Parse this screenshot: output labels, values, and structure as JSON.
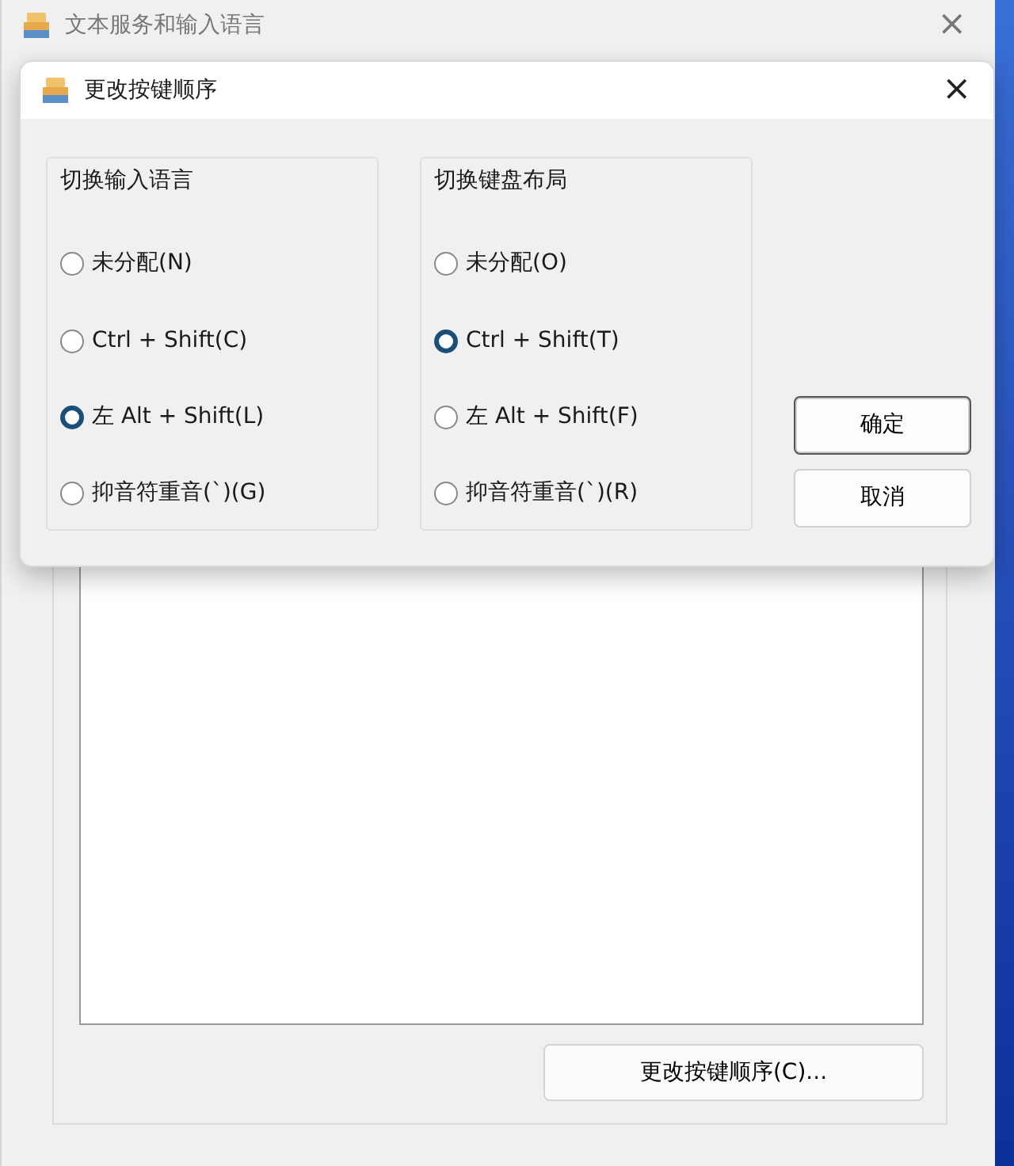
{
  "background_window": {
    "title": "文本服务和输入语言",
    "close": "×",
    "button": "更改按键顺序(C)..."
  },
  "dialog": {
    "title": "更改按键顺序",
    "close": "×",
    "groups": [
      {
        "title": "切换输入语言",
        "options": [
          {
            "label": "未分配(N)",
            "selected": false
          },
          {
            "label": "Ctrl + Shift(C)",
            "selected": false
          },
          {
            "label": "左 Alt + Shift(L)",
            "selected": true
          },
          {
            "label": "抑音符重音(`)(G)",
            "selected": false
          }
        ]
      },
      {
        "title": "切换键盘布局",
        "options": [
          {
            "label": "未分配(O)",
            "selected": false
          },
          {
            "label": "Ctrl + Shift(T)",
            "selected": true
          },
          {
            "label": "左 Alt + Shift(F)",
            "selected": false
          },
          {
            "label": "抑音符重音(`)(R)",
            "selected": false
          }
        ]
      }
    ],
    "buttons": [
      {
        "label": "确定",
        "default": true
      },
      {
        "label": "取消",
        "default": false
      }
    ]
  }
}
